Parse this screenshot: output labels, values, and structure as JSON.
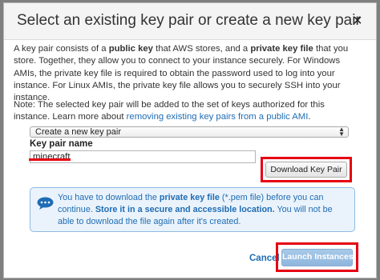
{
  "dialog": {
    "title": "Select an existing key pair or create a new key pair",
    "close_glyph": "×",
    "intro": {
      "t1": "A key pair consists of a ",
      "b1": "public key",
      "t2": " that AWS stores, and a ",
      "b2": "private key file",
      "t3": " that you store. Together, they allow you to connect to your instance securely. For Windows AMIs, the private key file is required to obtain the password used to log into your instance. For Linux AMIs, the private key file allows you to securely SSH into your instance."
    },
    "note": {
      "text": "Note: The selected key pair will be added to the set of keys authorized for this instance. Learn more about ",
      "link": "removing existing key pairs from a public AMI",
      "end": "."
    },
    "key_pair_select": {
      "selected": "Create a new key pair"
    },
    "key_pair_name": {
      "label": "Key pair name",
      "value": "minecraft"
    },
    "download_button": "Download Key Pair",
    "info": {
      "icon": "speech-bubble-icon",
      "t1": "You have to download the ",
      "b1": "private key file",
      "t2": " (*.pem file) before you can continue. ",
      "b2": "Store it in a secure and accessible location.",
      "t3": " You will not be able to download the file again after it's created."
    },
    "cancel_label": "Cancel",
    "launch_label": "Launch Instances"
  },
  "colors": {
    "highlight_red": "#e60012",
    "link_blue": "#1f6cb4",
    "info_bg": "#eaf3fb",
    "launch_disabled": "#9bbfe3"
  }
}
